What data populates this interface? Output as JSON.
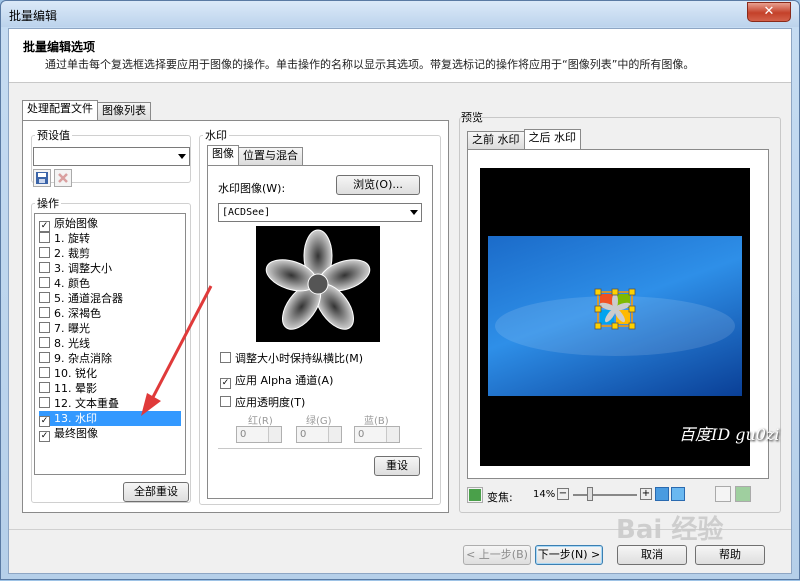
{
  "window": {
    "title": "批量编辑",
    "close": "✕"
  },
  "header": {
    "title": "批量编辑选项",
    "description": "通过单击每个复选框选择要应用于图像的操作。单击操作的名称以显示其选项。带复选标记的操作将应用于“图像列表”中的所有图像。"
  },
  "left_tabs": [
    "处理配置文件",
    "图像列表"
  ],
  "presets": {
    "label": "预设值",
    "value": ""
  },
  "operations": {
    "label": "操作",
    "items": [
      {
        "label": "原始图像",
        "checked": true
      },
      {
        "label": "1.  旋转",
        "checked": false
      },
      {
        "label": "2.  裁剪",
        "checked": false
      },
      {
        "label": "3.  调整大小",
        "checked": false
      },
      {
        "label": "4.  颜色",
        "checked": false
      },
      {
        "label": "5.  通道混合器",
        "checked": false
      },
      {
        "label": "6.  深褐色",
        "checked": false
      },
      {
        "label": "7.  曝光",
        "checked": false
      },
      {
        "label": "8.  光线",
        "checked": false
      },
      {
        "label": "9.  杂点消除",
        "checked": false
      },
      {
        "label": "10.  锐化",
        "checked": false
      },
      {
        "label": "11.  晕影",
        "checked": false
      },
      {
        "label": "12.  文本重叠",
        "checked": false
      },
      {
        "label": "13.  水印",
        "checked": true,
        "selected": true
      },
      {
        "label": "最终图像",
        "checked": true
      }
    ],
    "reset_all": "全部重设"
  },
  "watermark": {
    "title": "水印",
    "tabs": [
      "图像",
      "位置与混合"
    ],
    "image_label": "水印图像(W):",
    "browse": "浏览(O)...",
    "image_value": "[ACDSee]",
    "keep_ratio": "调整大小时保持纵横比(M)",
    "apply_alpha": "应用 Alpha 通道(A)",
    "apply_transparency": "应用透明度(T)",
    "red": "红(R)",
    "green": "绿(G)",
    "blue": "蓝(B)",
    "red_val": "0",
    "green_val": "0",
    "blue_val": "0",
    "reset": "重设"
  },
  "preview": {
    "label": "预览",
    "tabs": [
      "之前 水印",
      "之后 水印"
    ],
    "zoom_label": "变焦:",
    "zoom_value": "14%"
  },
  "footer": {
    "prev": "< 上一步(B)",
    "next": "下一步(N) >",
    "cancel": "取消",
    "help": "帮助"
  },
  "overlay": {
    "credit": "百度ID gu0zi",
    "baidu_logo": "Bai 经验",
    "arrow_color": "#e03a3a"
  }
}
